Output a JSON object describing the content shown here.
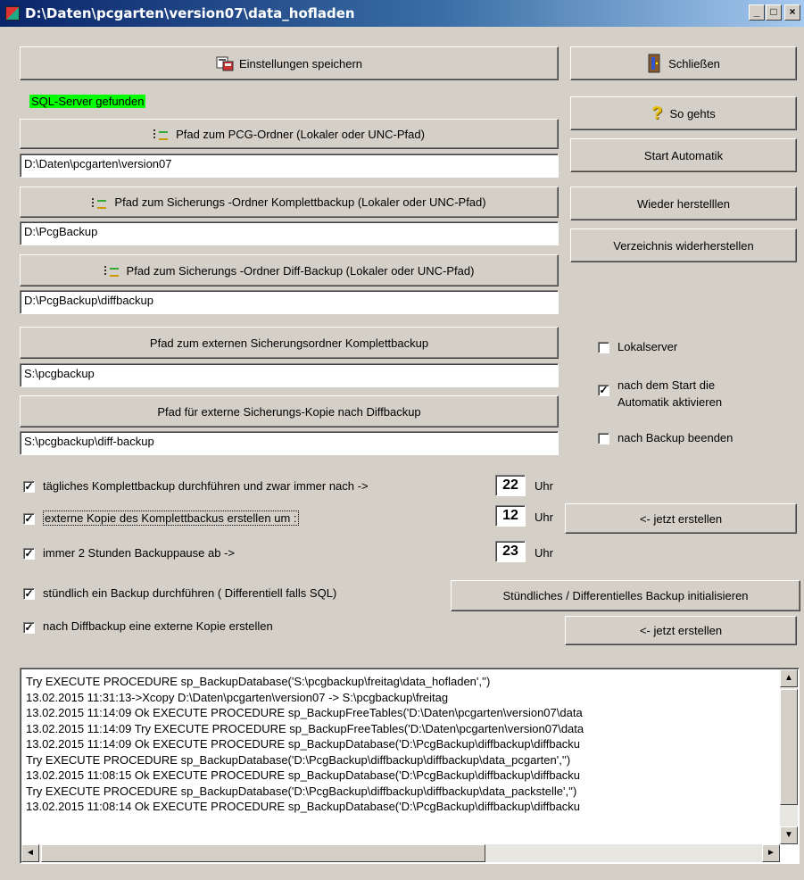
{
  "window": {
    "title": "D:\\Daten\\pcgarten\\version07\\data_hofladen"
  },
  "titlebar_buttons": {
    "minimize": "_",
    "maximize": "□",
    "close": "×"
  },
  "buttons": {
    "save_settings": "Einstellungen speichern",
    "close": "Schließen",
    "help": "So gehts",
    "start_auto": "Start Automatik",
    "restore": "Wieder herstelllen",
    "restore_dir": "Verzeichnis widerherstellen",
    "pcg_path": "Pfad zum PCG-Ordner (Lokaler oder UNC-Pfad)",
    "full_backup_path": "Pfad zum Sicherungs -Ordner Komplettbackup (Lokaler oder UNC-Pfad)",
    "diff_backup_path": "Pfad zum Sicherungs -Ordner Diff-Backup (Lokaler oder UNC-Pfad)",
    "ext_full_path": "Pfad zum externen Sicherungsordner Komplettbackup",
    "ext_diff_path": "Pfad für externe Sicherungs-Kopie nach Diffbackup",
    "create_now_1": "<- jetzt erstellen",
    "hourly_init": "Stündliches / Differentielles Backup initialisieren",
    "create_now_2": "<- jetzt erstellen"
  },
  "status": "SQL-Server gefunden",
  "fields": {
    "pcg_path": "D:\\Daten\\pcgarten\\version07",
    "full_backup_path": "D:\\PcgBackup",
    "diff_backup_path": "D:\\PcgBackup\\diffbackup",
    "ext_full_path": "S:\\pcgbackup",
    "ext_diff_path": "S:\\pcgbackup\\diff-backup"
  },
  "right_options": {
    "lokalserver": {
      "label": "Lokalserver",
      "checked": false
    },
    "auto_start_line1": "nach dem Start die",
    "auto_start_line2": "Automatik aktivieren",
    "auto_start_checked": true,
    "quit_after": {
      "label": "nach Backup beenden",
      "checked": false
    }
  },
  "schedule": {
    "daily": {
      "label": "tägliches Komplettbackup durchführen  und zwar immer nach ->",
      "hour": "22",
      "unit": "Uhr",
      "checked": true
    },
    "external": {
      "label": "externe Kopie des Komplettbackus erstellen um :",
      "hour": "12",
      "unit": "Uhr",
      "checked": true
    },
    "pause": {
      "label": "immer 2 Stunden Backuppause ab  ->",
      "hour": "23",
      "unit": "Uhr",
      "checked": true
    },
    "hourly": {
      "label": "stündlich ein  Backup durchführen ( Differentiell falls SQL)",
      "checked": true
    },
    "diff_copy": {
      "label": "nach Diffbackup eine externe Kopie erstellen",
      "checked": true
    }
  },
  "log": [
    "Try EXECUTE PROCEDURE sp_BackupDatabase('S:\\pcgbackup\\freitag\\data_hofladen','')",
    "13.02.2015 11:31:13->Xcopy D:\\Daten\\pcgarten\\version07 -> S:\\pcgbackup\\freitag",
    "13.02.2015 11:14:09 Ok  EXECUTE PROCEDURE sp_BackupFreeTables('D:\\Daten\\pcgarten\\version07\\data",
    "13.02.2015 11:14:09 Try EXECUTE PROCEDURE sp_BackupFreeTables('D:\\Daten\\pcgarten\\version07\\data",
    "13.02.2015 11:14:09 Ok  EXECUTE PROCEDURE sp_BackupDatabase('D:\\PcgBackup\\diffbackup\\diffbacku",
    "Try EXECUTE PROCEDURE sp_BackupDatabase('D:\\PcgBackup\\diffbackup\\diffbackup\\data_pcgarten','')",
    "13.02.2015 11:08:15 Ok  EXECUTE PROCEDURE sp_BackupDatabase('D:\\PcgBackup\\diffbackup\\diffbacku",
    "Try EXECUTE PROCEDURE sp_BackupDatabase('D:\\PcgBackup\\diffbackup\\diffbackup\\data_packstelle','')",
    "13.02.2015 11:08:14 Ok  EXECUTE PROCEDURE sp_BackupDatabase('D:\\PcgBackup\\diffbackup\\diffbacku"
  ],
  "scroll": {
    "up": "▲",
    "down": "▼",
    "left": "◄",
    "right": "►"
  },
  "icons": {
    "save": "save-settings-icon",
    "close": "exit-door-icon",
    "help": "question-mark-icon",
    "folder": "folder-tree-icon"
  }
}
